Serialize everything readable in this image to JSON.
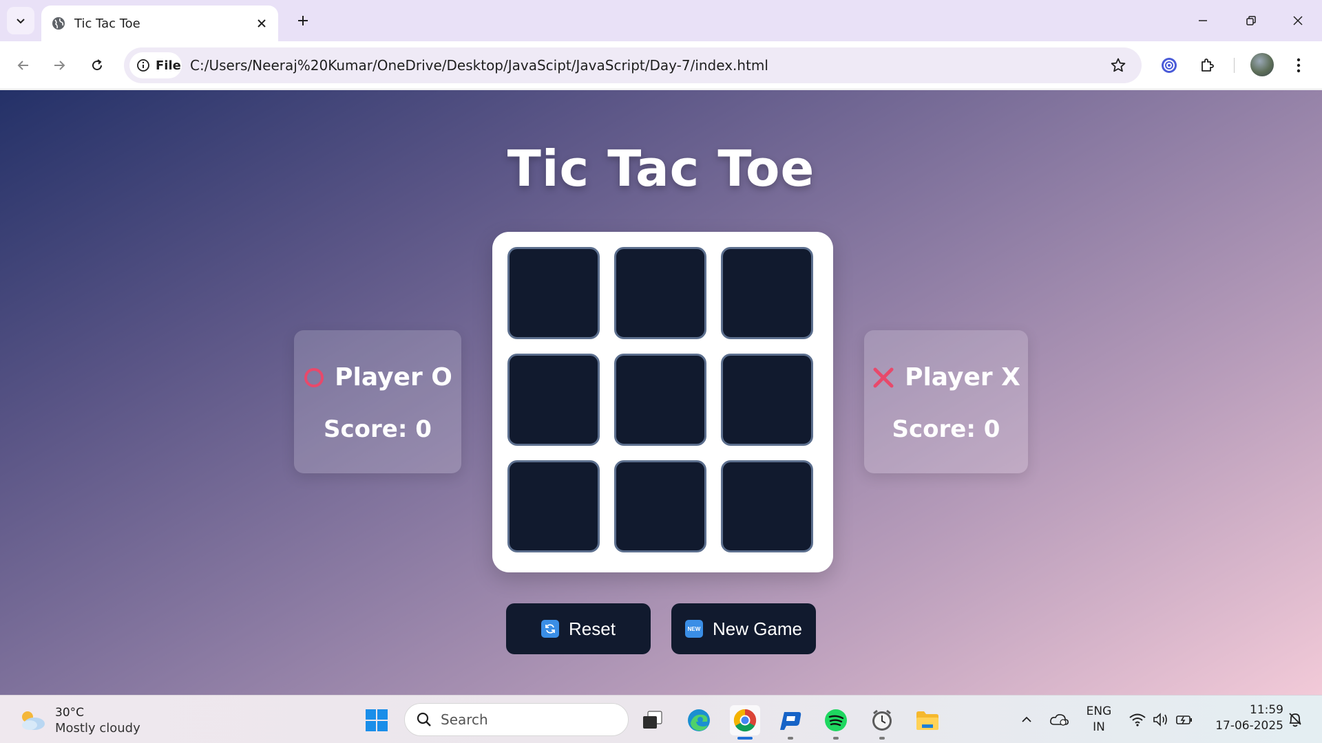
{
  "browser": {
    "tab_title": "Tic Tac Toe",
    "site_chip": "File",
    "url": "C:/Users/Neeraj%20Kumar/OneDrive/Desktop/JavaScipt/JavaScript/Day-7/index.html"
  },
  "page": {
    "title": "Tic Tac Toe",
    "board": {
      "cells": [
        "",
        "",
        "",
        "",
        "",
        "",
        "",
        "",
        ""
      ]
    },
    "players": [
      {
        "symbol": "O",
        "icon": "circle-icon",
        "name": "Player O",
        "score_label": "Score: 0",
        "color": "#e8496b"
      },
      {
        "symbol": "X",
        "icon": "cross-icon",
        "name": "Player X",
        "score_label": "Score: 0",
        "color": "#e8496b"
      }
    ],
    "buttons": {
      "reset_label": "Reset",
      "reset_icon": "reset-emoji-icon",
      "new_game_label": "New Game",
      "new_game_icon": "new-emoji-icon",
      "new_badge_text": "NEW"
    },
    "colors": {
      "cell_bg": "#111a2e",
      "board_bg": "#ffffff",
      "button_bg": "#111a2e"
    }
  },
  "taskbar": {
    "weather_temp": "30°C",
    "weather_desc": "Mostly cloudy",
    "search_placeholder": "Search",
    "lang_line1": "ENG",
    "lang_line2": "IN",
    "time": "11:59",
    "date": "17-06-2025"
  }
}
